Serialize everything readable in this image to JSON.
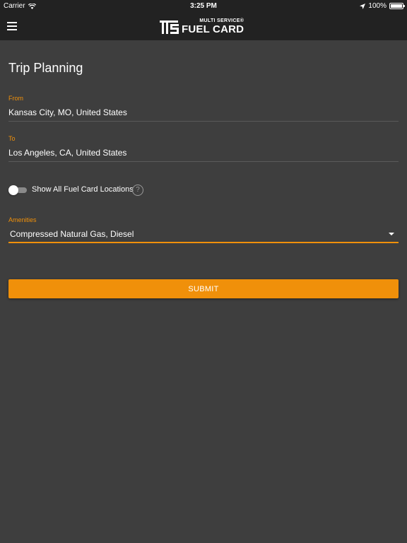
{
  "status_bar": {
    "carrier": "Carrier",
    "time": "3:25 PM",
    "battery": "100%",
    "battery_level": 1.0
  },
  "app_bar": {
    "menu_icon": "hamburger-menu-icon",
    "logo_top": "MULTI SERVICE®",
    "logo_bottom": "FUEL CARD"
  },
  "page": {
    "title": "Trip Planning"
  },
  "form": {
    "from": {
      "label": "From",
      "value": "Kansas City, MO, United States"
    },
    "to": {
      "label": "To",
      "value": "Los Angeles, CA, United States"
    },
    "show_all": {
      "label": "Show All Fuel Card Locations",
      "enabled": false,
      "help_symbol": "?"
    },
    "amenities": {
      "label": "Amenities",
      "value": "Compressed Natural Gas, Diesel"
    },
    "submit_label": "SUBMIT"
  },
  "colors": {
    "accent": "#f0900a",
    "background": "#3e3e3e",
    "bar": "#222222"
  }
}
